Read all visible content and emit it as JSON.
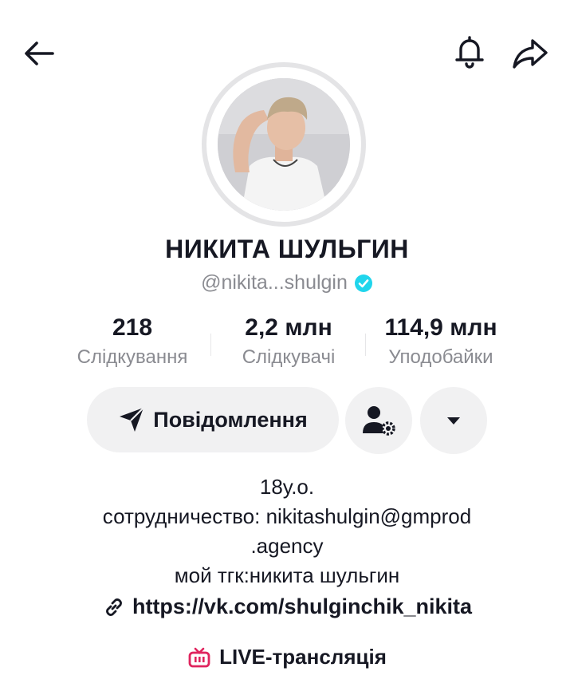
{
  "header": {
    "back_icon": "arrow-left-icon",
    "bell_icon": "bell-icon",
    "share_icon": "share-arrow-icon"
  },
  "profile": {
    "name": "НИКИТА ШУЛЬГИН",
    "handle": "@nikita...shulgin",
    "verified_icon": "verified-check-icon",
    "verified_color": "#20d5ec"
  },
  "stats": [
    {
      "value": "218",
      "label": "Слідкування"
    },
    {
      "value": "2,2 млн",
      "label": "Слідкувачі"
    },
    {
      "value": "114,9 млн",
      "label": "Уподобайки"
    }
  ],
  "actions": {
    "message_label": "Повідомлення",
    "message_icon": "send-arrow-icon",
    "follow_settings_icon": "user-gear-icon",
    "more_icon": "caret-down-icon"
  },
  "bio": {
    "lines": [
      "18у.о.",
      "сотрудничество: nikitashulgin@gmprod",
      ".agency",
      "мой тгк:никита шульгин"
    ],
    "link_icon": "link-icon",
    "link": "https://vk.com/shulginchik_nikita"
  },
  "live": {
    "label": "LIVE-трансляція",
    "icon": "live-tv-icon",
    "icon_color": "#e0245e"
  }
}
